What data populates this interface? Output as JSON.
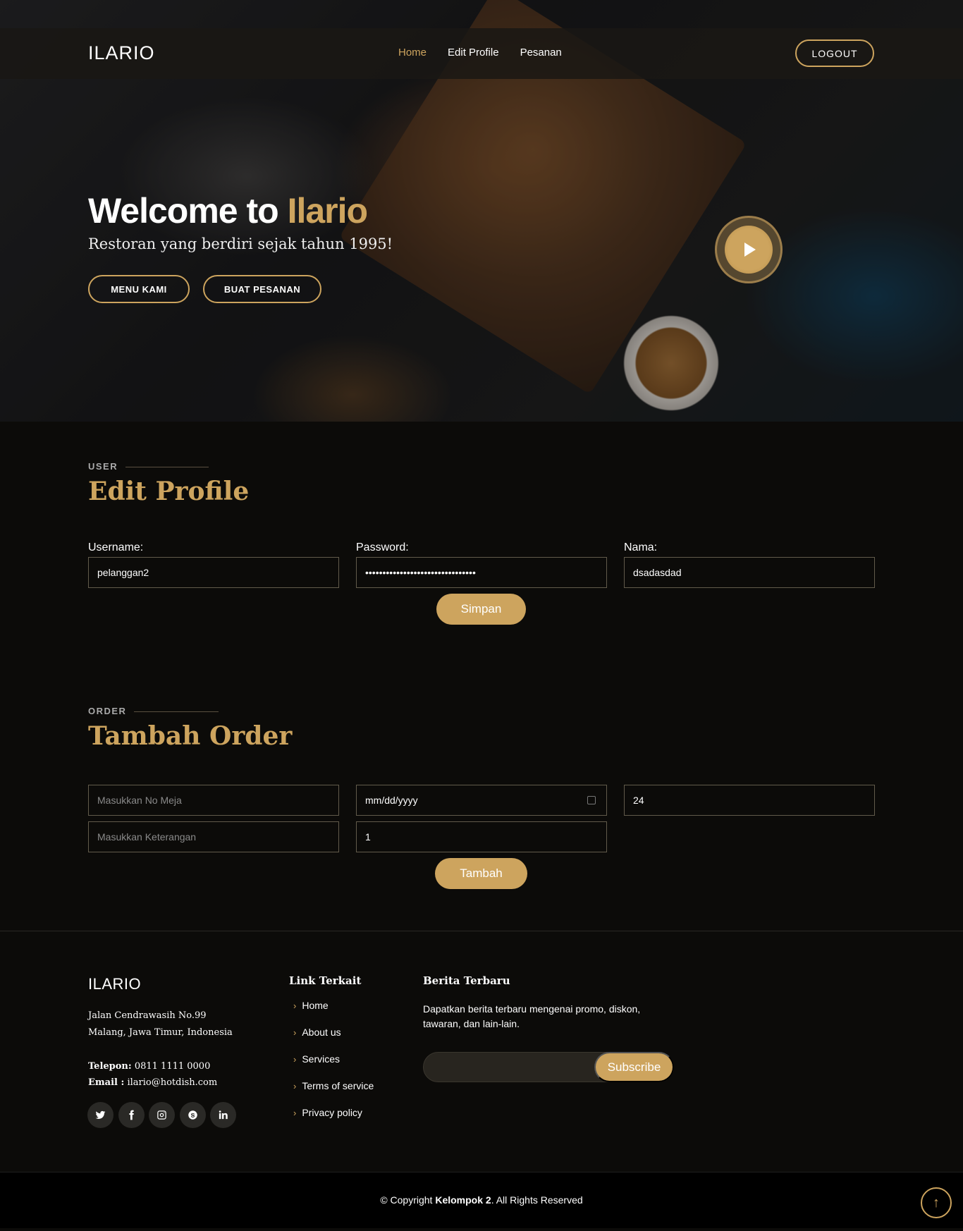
{
  "brand": "ILARIO",
  "nav": {
    "home": "Home",
    "edit_profile": "Edit Profile",
    "pesanan": "Pesanan",
    "logout": "LOGOUT"
  },
  "hero": {
    "title_main": "Welcome to",
    "title_accent": "Ilario",
    "subtitle": "Restoran yang berdiri sejak tahun 1995!",
    "btn_menu": "MENU KAMI",
    "btn_order": "BUAT PESANAN"
  },
  "profile": {
    "label": "USER",
    "title": "Edit Profile",
    "username_label": "Username:",
    "username_value": "pelanggan2",
    "password_label": "Password:",
    "password_value": "••••••••••••••••••••••••••••••••",
    "nama_label": "Nama:",
    "nama_value": "dsadasdad",
    "submit": "Simpan"
  },
  "order": {
    "label": "ORDER",
    "title": "Tambah Order",
    "meja_placeholder": "Masukkan No Meja",
    "date_placeholder": "mm/dd/yyyy",
    "third_value": "24",
    "keterangan_placeholder": "Masukkan Keterangan",
    "qty_value": "1",
    "submit": "Tambah"
  },
  "footer": {
    "logo": "ILARIO",
    "address_line1": "Jalan Cendrawasih No.99",
    "address_line2": "Malang, Jawa Timur, Indonesia",
    "phone_label": "Telepon:",
    "phone": "0811 1111 0000",
    "email_label": "Email :",
    "email": "ilario@hotdish.com",
    "links_title": "Link Terkait",
    "links": [
      "Home",
      "About us",
      "Services",
      "Terms of service",
      "Privacy policy"
    ],
    "news_title": "Berita Terbaru",
    "news_text": "Dapatkan berita terbaru mengenai promo, diskon, tawaran, dan lain-lain.",
    "subscribe": "Subscribe",
    "social": [
      "twitter-icon",
      "facebook-icon",
      "instagram-icon",
      "skype-icon",
      "linkedin-icon"
    ]
  },
  "copyright": {
    "prefix": "© Copyright",
    "owner": "Kelompok 2",
    "suffix": ". All Rights Reserved"
  },
  "colors": {
    "accent": "#cda45e",
    "background": "#0c0b09"
  }
}
